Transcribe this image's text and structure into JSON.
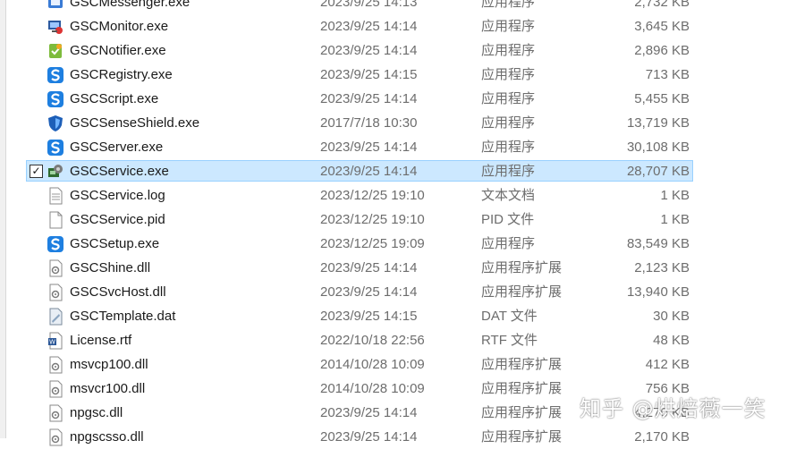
{
  "files": [
    {
      "name": "GSCMessenger.exe",
      "date": "2023/9/25 14:13",
      "type": "应用程序",
      "size": "2,732 KB",
      "icon": "app-icon-messenger"
    },
    {
      "name": "GSCMonitor.exe",
      "date": "2023/9/25 14:14",
      "type": "应用程序",
      "size": "3,645 KB",
      "icon": "app-icon-monitor"
    },
    {
      "name": "GSCNotifier.exe",
      "date": "2023/9/25 14:14",
      "type": "应用程序",
      "size": "2,896 KB",
      "icon": "app-icon-notifier"
    },
    {
      "name": "GSCRegistry.exe",
      "date": "2023/9/25 14:15",
      "type": "应用程序",
      "size": "713 KB",
      "icon": "app-icon-blue-s"
    },
    {
      "name": "GSCScript.exe",
      "date": "2023/9/25 14:14",
      "type": "应用程序",
      "size": "5,455 KB",
      "icon": "app-icon-blue-s"
    },
    {
      "name": "GSCSenseShield.exe",
      "date": "2017/7/18 10:30",
      "type": "应用程序",
      "size": "13,719 KB",
      "icon": "app-icon-shield"
    },
    {
      "name": "GSCServer.exe",
      "date": "2023/9/25 14:14",
      "type": "应用程序",
      "size": "30,108 KB",
      "icon": "app-icon-blue-s"
    },
    {
      "name": "GSCService.exe",
      "date": "2023/9/25 14:14",
      "type": "应用程序",
      "size": "28,707 KB",
      "icon": "app-icon-service",
      "selected": true
    },
    {
      "name": "GSCService.log",
      "date": "2023/12/25 19:10",
      "type": "文本文档",
      "size": "1 KB",
      "icon": "text-file-icon"
    },
    {
      "name": "GSCService.pid",
      "date": "2023/12/25 19:10",
      "type": "PID 文件",
      "size": "1 KB",
      "icon": "blank-file-icon"
    },
    {
      "name": "GSCSetup.exe",
      "date": "2023/12/25 19:09",
      "type": "应用程序",
      "size": "83,549 KB",
      "icon": "app-icon-blue-s"
    },
    {
      "name": "GSCShine.dll",
      "date": "2023/9/25 14:14",
      "type": "应用程序扩展",
      "size": "2,123 KB",
      "icon": "dll-file-icon"
    },
    {
      "name": "GSCSvcHost.dll",
      "date": "2023/9/25 14:14",
      "type": "应用程序扩展",
      "size": "13,940 KB",
      "icon": "dll-file-icon"
    },
    {
      "name": "GSCTemplate.dat",
      "date": "2023/9/25 14:15",
      "type": "DAT 文件",
      "size": "30 KB",
      "icon": "dat-file-icon"
    },
    {
      "name": "License.rtf",
      "date": "2022/10/18 22:56",
      "type": "RTF 文件",
      "size": "48 KB",
      "icon": "rtf-file-icon"
    },
    {
      "name": "msvcp100.dll",
      "date": "2014/10/28 10:09",
      "type": "应用程序扩展",
      "size": "412 KB",
      "icon": "dll-file-icon"
    },
    {
      "name": "msvcr100.dll",
      "date": "2014/10/28 10:09",
      "type": "应用程序扩展",
      "size": "756 KB",
      "icon": "dll-file-icon"
    },
    {
      "name": "npgsc.dll",
      "date": "2023/9/25 14:14",
      "type": "应用程序扩展",
      "size": "4,270 KB",
      "icon": "dll-file-icon"
    },
    {
      "name": "npgscsso.dll",
      "date": "2023/9/25 14:14",
      "type": "应用程序扩展",
      "size": "2,170 KB",
      "icon": "dll-file-icon"
    }
  ],
  "selection_checkmark": "✓",
  "watermark": "知乎 @烘焙薇一笑"
}
